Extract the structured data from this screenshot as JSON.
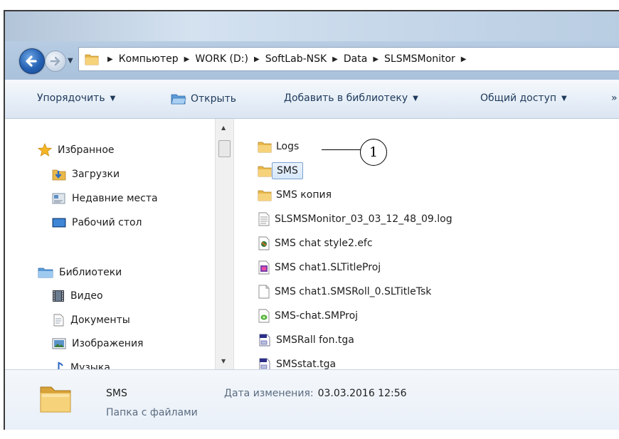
{
  "address": {
    "crumbs": [
      "Компьютер",
      "WORK (D:)",
      "SoftLab-NSK",
      "Data",
      "SLSMSMonitor"
    ]
  },
  "toolbar": {
    "organize": "Упорядочить",
    "open": "Открыть",
    "add_library": "Добавить в библиотеку",
    "share": "Общий доступ",
    "more": "»"
  },
  "sidebar": {
    "favorites": "Избранное",
    "downloads": "Загрузки",
    "recent": "Недавние места",
    "desktop": "Рабочий стол",
    "libraries": "Библиотеки",
    "video": "Видео",
    "documents": "Документы",
    "pictures": "Изображения",
    "music": "Музыка"
  },
  "files": [
    {
      "name": "Logs",
      "icon": "folder-icon"
    },
    {
      "name": "SMS",
      "icon": "folder-icon",
      "selected": true
    },
    {
      "name": "SMS копия",
      "icon": "folder-icon"
    },
    {
      "name": "SLSMSMonitor_03_03_12_48_09.log",
      "icon": "text-file-icon"
    },
    {
      "name": "SMS chat style2.efc",
      "icon": "efc-file-icon"
    },
    {
      "name": "SMS chat1.SLTitleProj",
      "icon": "titleproj-file-icon"
    },
    {
      "name": "SMS chat1.SMSRoll_0.SLTitleTsk",
      "icon": "blank-file-icon"
    },
    {
      "name": "SMS-chat.SMProj",
      "icon": "smproj-file-icon"
    },
    {
      "name": "SMSRall fon.tga",
      "icon": "tga-file-icon"
    },
    {
      "name": "SMSstat.tga",
      "icon": "tga-file-icon"
    }
  ],
  "callout": {
    "number": "1"
  },
  "details": {
    "name": "SMS",
    "type": "Папка с файлами",
    "date_label": "Дата изменения:",
    "date_value": "03.03.2016 12:56"
  }
}
